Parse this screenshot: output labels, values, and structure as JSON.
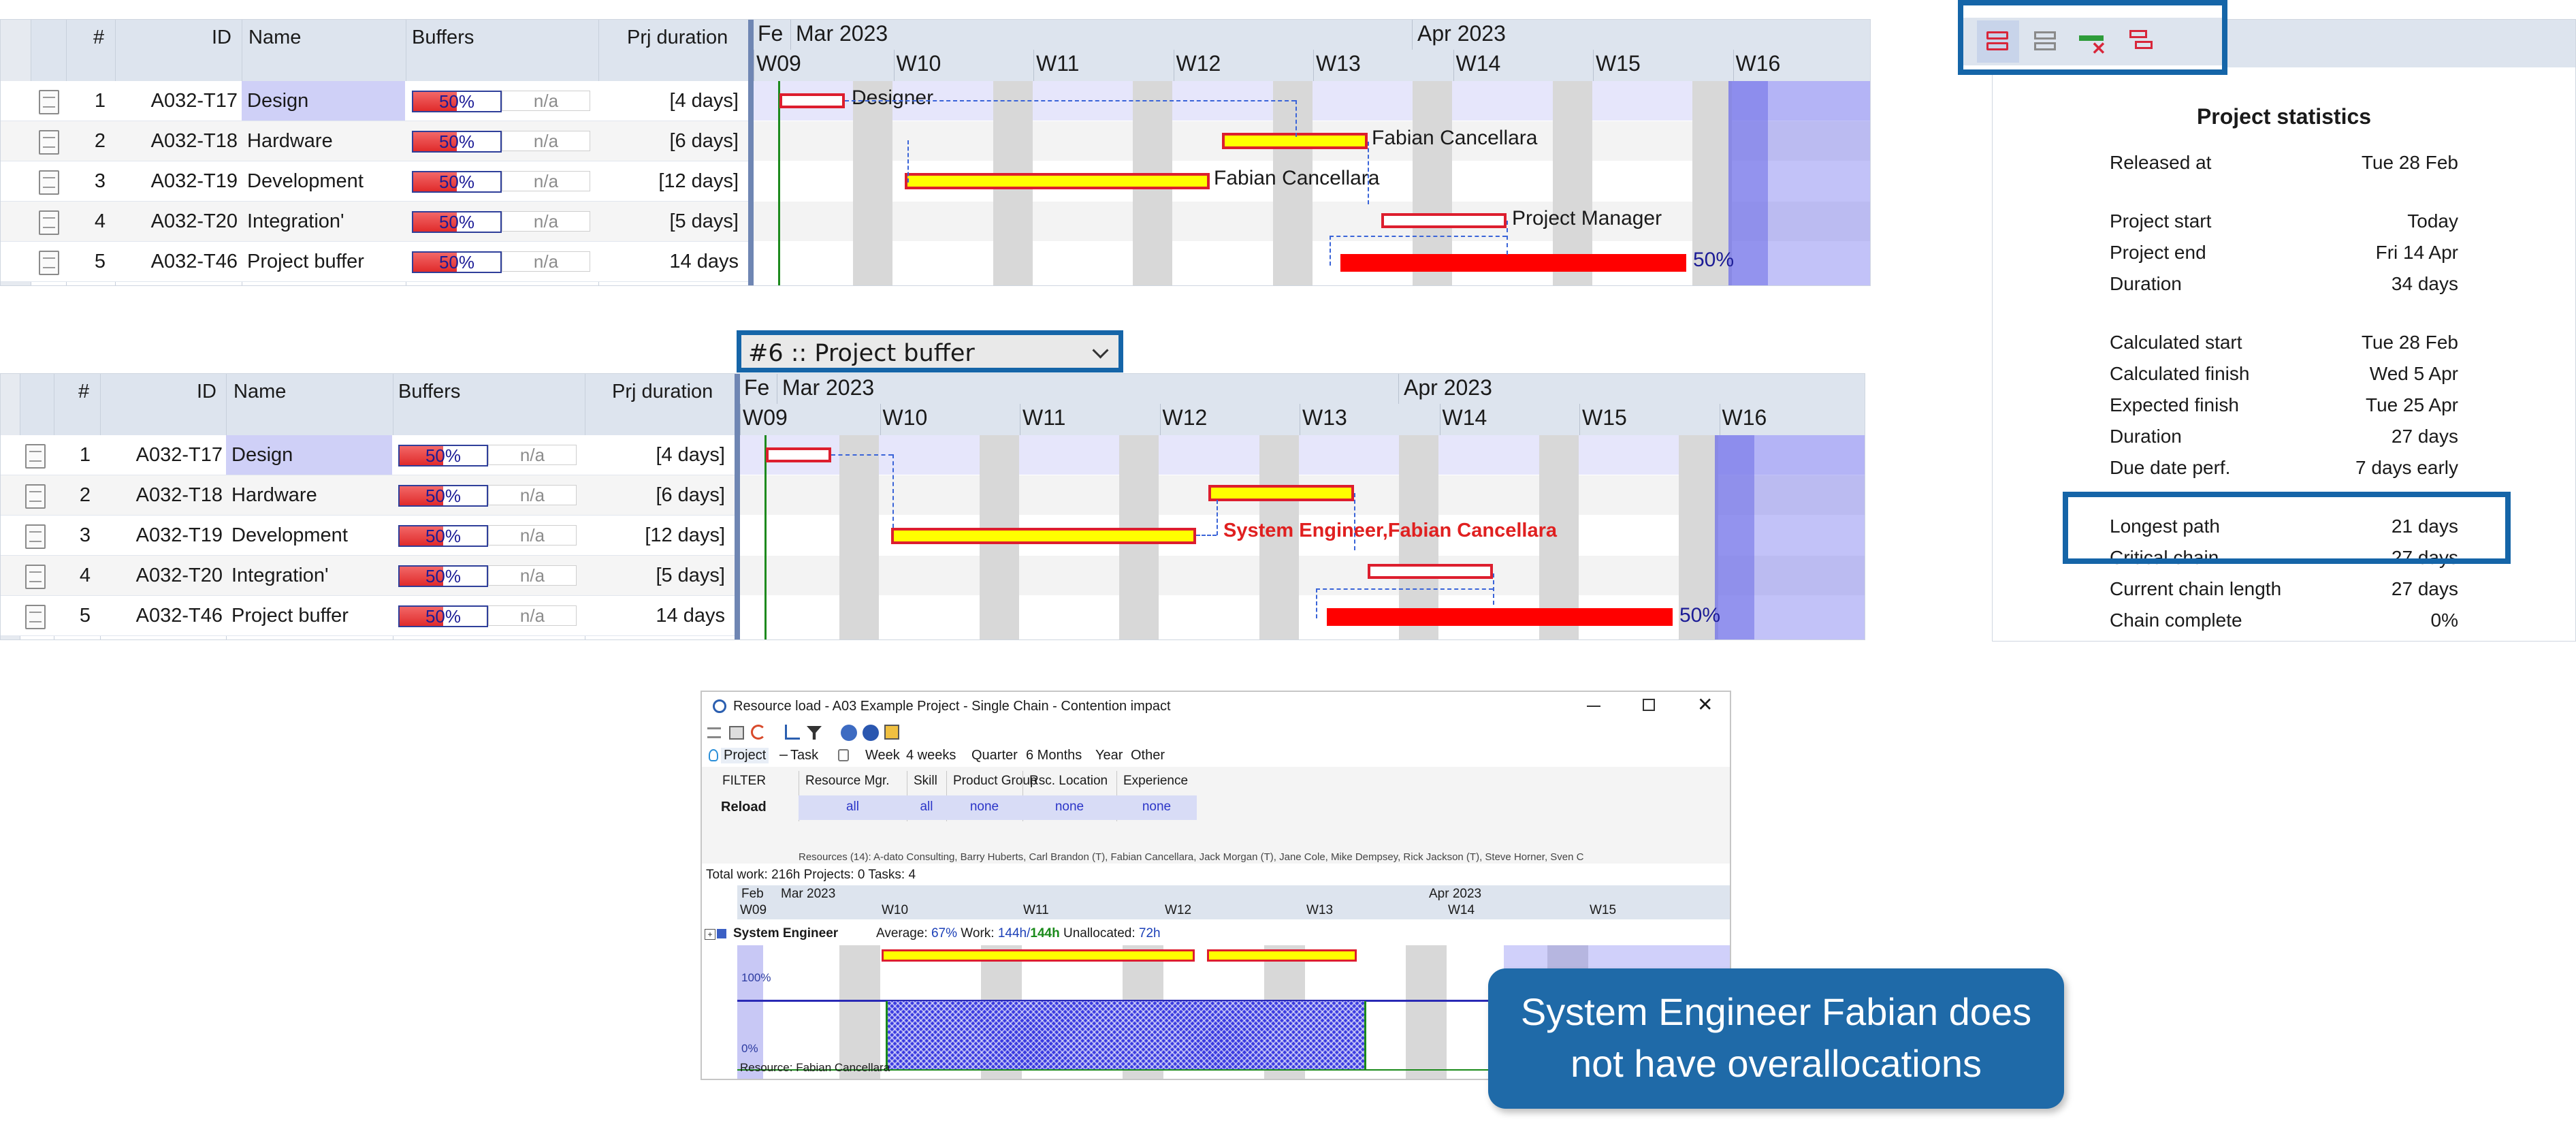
{
  "colors": {
    "accent_blue": "#1565a8",
    "header_bg": "#dde4ee",
    "name_highlight": "#cfd0f7",
    "bar_border": "#dd1e2e",
    "bar_yellow": "#ffff00",
    "buffer_red": "#ff0000",
    "callout_bg": "#1f6aa8",
    "chain_label": "#e02020"
  },
  "table_headers": {
    "num": "#",
    "id": "ID",
    "name": "Name",
    "buffers": "Buffers",
    "duration": "Prj duration"
  },
  "gantt_header": {
    "feb": "Fe",
    "mar": "Mar 2023",
    "apr": "Apr 2023",
    "weeks": [
      "W09",
      "W10",
      "W11",
      "W12",
      "W13",
      "W14",
      "W15",
      "W16"
    ]
  },
  "gantt1": {
    "rows": [
      {
        "num": "1",
        "id": "A032-T17",
        "name": "Design",
        "buffer": "50%",
        "na": "n/a",
        "duration": "[4 days]",
        "label": "Designer"
      },
      {
        "num": "2",
        "id": "A032-T18",
        "name": "Hardware",
        "buffer": "50%",
        "na": "n/a",
        "duration": "[6 days]",
        "label": "Fabian Cancellara"
      },
      {
        "num": "3",
        "id": "A032-T19",
        "name": "Development",
        "buffer": "50%",
        "na": "n/a",
        "duration": "[12 days]",
        "label": "Fabian Cancellara"
      },
      {
        "num": "4",
        "id": "A032-T20",
        "name": "Integration'",
        "buffer": "50%",
        "na": "n/a",
        "duration": "[5 days]",
        "label": "Project Manager"
      },
      {
        "num": "5",
        "id": "A032-T46",
        "name": "Project buffer",
        "buffer": "50%",
        "na": "n/a",
        "duration": "14 days",
        "label": "50%"
      }
    ]
  },
  "gantt2": {
    "selector": "#6 :: Project buffer",
    "chain_label": "System Engineer,Fabian Cancellara",
    "buffer_label": "50%",
    "rows": [
      {
        "num": "1",
        "id": "A032-T17",
        "name": "Design",
        "buffer": "50%",
        "na": "n/a",
        "duration": "[4 days]"
      },
      {
        "num": "2",
        "id": "A032-T18",
        "name": "Hardware",
        "buffer": "50%",
        "na": "n/a",
        "duration": "[6 days]"
      },
      {
        "num": "3",
        "id": "A032-T19",
        "name": "Development",
        "buffer": "50%",
        "na": "n/a",
        "duration": "[12 days]"
      },
      {
        "num": "4",
        "id": "A032-T20",
        "name": "Integration'",
        "buffer": "50%",
        "na": "n/a",
        "duration": "[5 days]"
      },
      {
        "num": "5",
        "id": "A032-T46",
        "name": "Project buffer",
        "buffer": "50%",
        "na": "n/a",
        "duration": "14 days"
      }
    ]
  },
  "stats": {
    "title": "Project statistics",
    "toolbar_icons": [
      "swap-red-icon",
      "swap-grey-icon",
      "remove-link-icon",
      "split-icon"
    ],
    "groups": [
      [
        {
          "k": "Released at",
          "v": "Tue 28 Feb"
        }
      ],
      [
        {
          "k": "Project start",
          "v": "Today"
        },
        {
          "k": "Project end",
          "v": "Fri 14 Apr"
        },
        {
          "k": "Duration",
          "v": "34 days"
        }
      ],
      [
        {
          "k": "Calculated start",
          "v": "Tue 28 Feb"
        },
        {
          "k": "Calculated finish",
          "v": "Wed 5 Apr"
        },
        {
          "k": "Expected finish",
          "v": "Tue 25 Apr"
        },
        {
          "k": "Duration",
          "v": "27 days"
        },
        {
          "k": "Due date perf.",
          "v": "7 days early"
        }
      ],
      [
        {
          "k": "Longest path",
          "v": "21 days"
        },
        {
          "k": "Critical chain",
          "v": "27 days"
        },
        {
          "k": "Current chain length",
          "v": "27 days"
        },
        {
          "k": "Chain complete",
          "v": "0%"
        }
      ]
    ]
  },
  "resource_window": {
    "title": "Resource load - A03 Example Project - Single Chain - Contention impact",
    "tabs": [
      "Project",
      "Task"
    ],
    "ranges": [
      "Week",
      "4 weeks",
      "Quarter",
      "6 Months",
      "Year",
      "Other"
    ],
    "filter_label": "FILTER",
    "reload_label": "Reload",
    "filters": [
      {
        "h": "Resource Mgr.",
        "v": "all"
      },
      {
        "h": "Skill",
        "v": "all"
      },
      {
        "h": "Product Group",
        "v": "none"
      },
      {
        "h": "Rsc. Location",
        "v": "none"
      },
      {
        "h": "Experience",
        "v": "none"
      }
    ],
    "resources_line": "Resources (14): A-dato Consulting, Barry Huberts, Carl Brandon (T), Fabian Cancellara, Jack Morgan (T), Jane Cole, Mike Dempsey, Rick Jackson (T), Steve Horner, Sven C",
    "totals": "Total work: 216h  Projects: 0  Tasks: 4",
    "months": {
      "feb": "Feb",
      "mar": "Mar 2023",
      "apr": "Apr 2023"
    },
    "weeks": [
      "W09",
      "W10",
      "W11",
      "W12",
      "W13",
      "W14",
      "W15"
    ],
    "group_name": "System Engineer",
    "avg_label": "Average:",
    "avg_value": "67%",
    "work_label": "Work:",
    "work_value": "144h/",
    "work_value2": "144h",
    "unalloc_label": "Unallocated:",
    "unalloc_value": "72h",
    "axis_top": "100%",
    "axis_bottom": "0%",
    "resource_label": "Resource: Fabian Cancellara"
  },
  "callout": {
    "line1": "System Engineer Fabian does",
    "line2": "not have overallocations"
  }
}
